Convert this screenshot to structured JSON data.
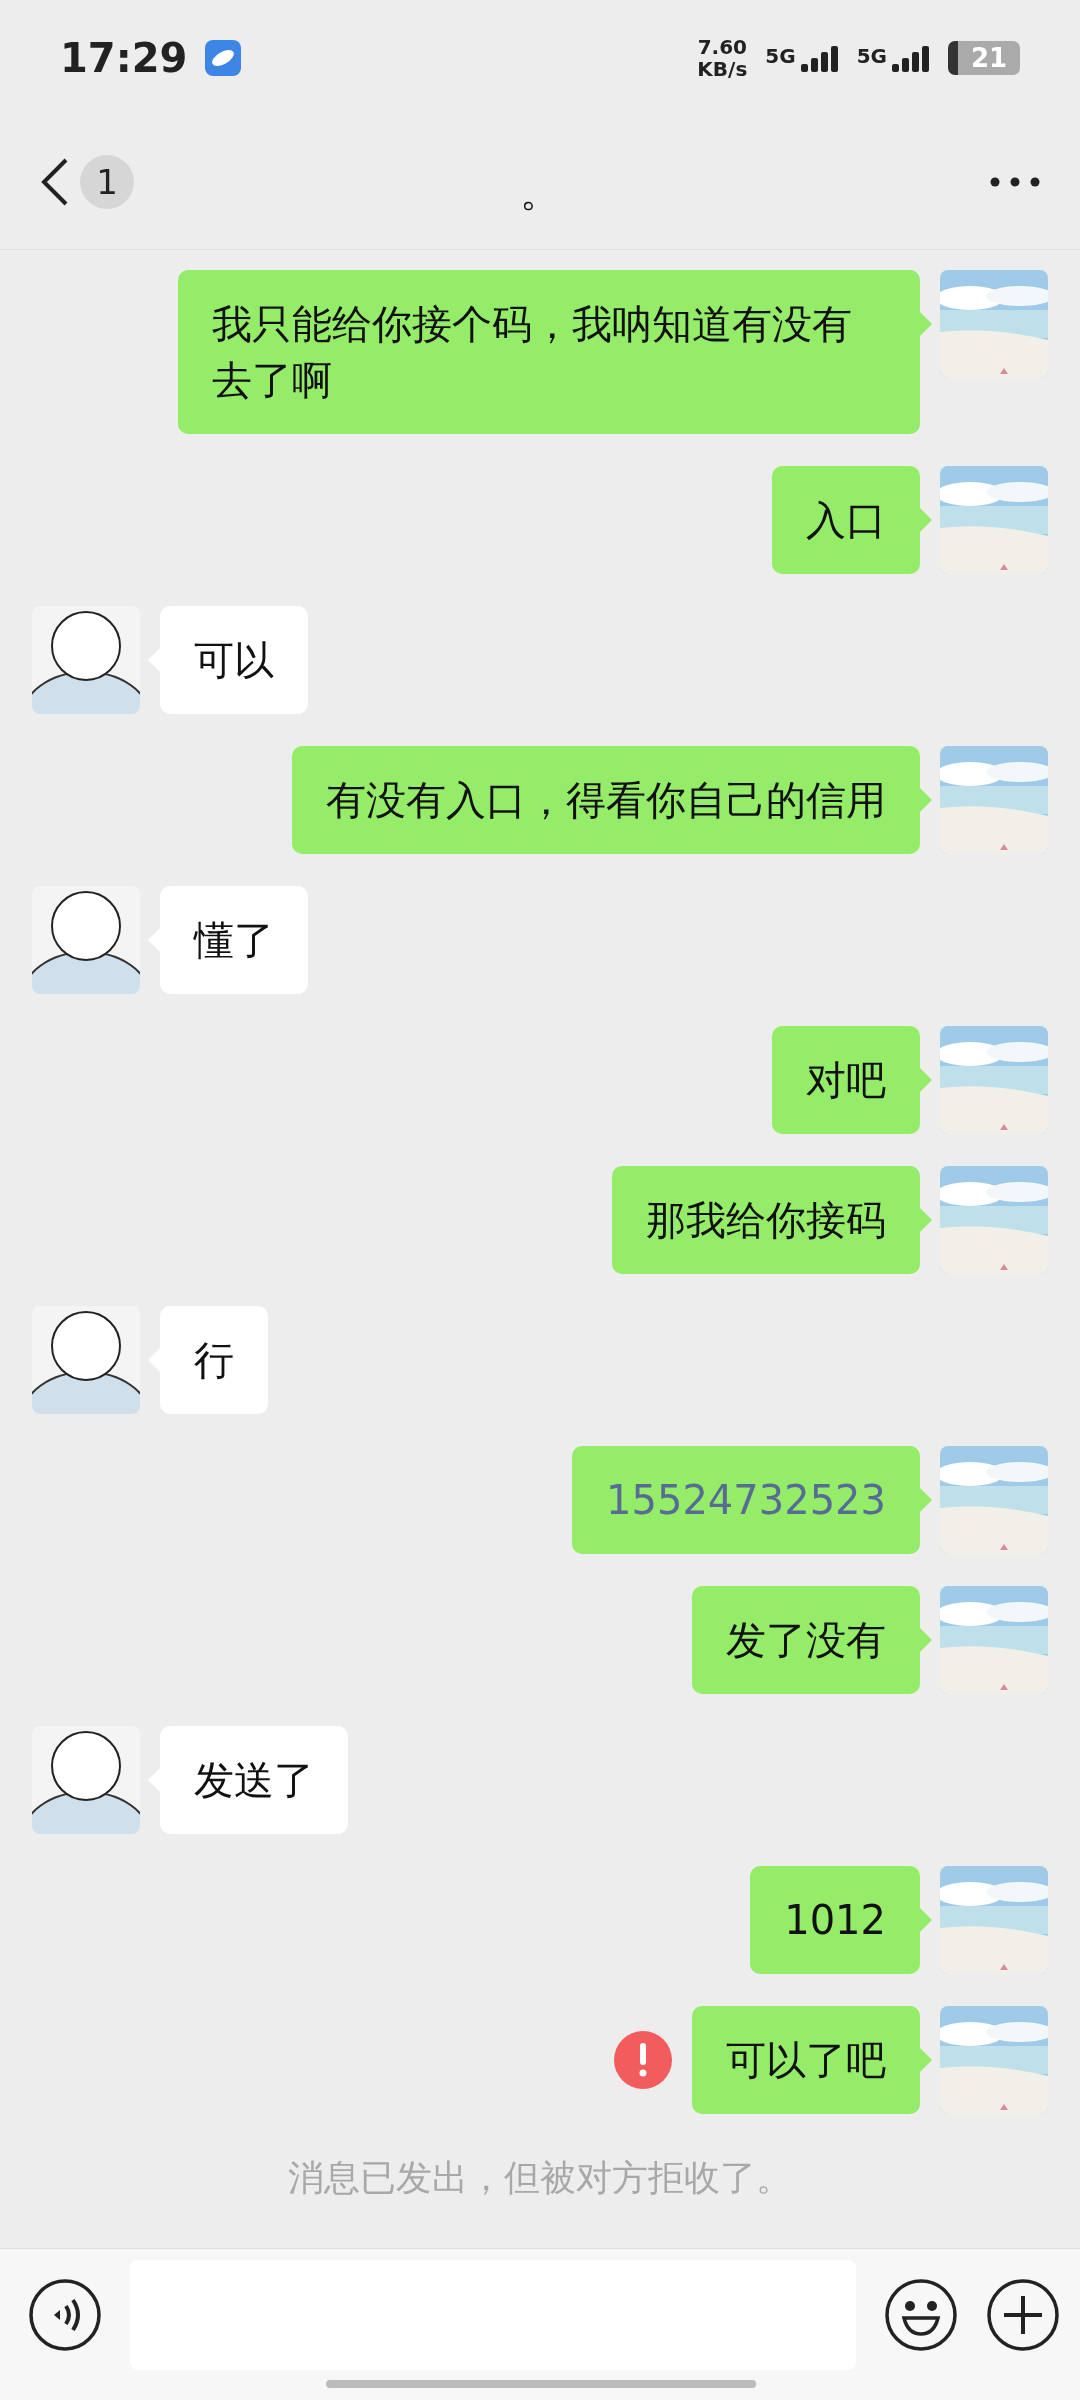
{
  "status_bar": {
    "time": "17:29",
    "net_speed": "7.60",
    "net_unit": "KB/s",
    "signal_1": "5G",
    "signal_2": "5G",
    "battery": "21"
  },
  "header": {
    "unread_badge": "1",
    "title": "。"
  },
  "messages": [
    {
      "outgoing": true,
      "kind": "text",
      "text": "我只能给你接个码，我呐知道有没有去了啊",
      "failed": false
    },
    {
      "outgoing": true,
      "kind": "text",
      "text": "入口",
      "failed": false
    },
    {
      "outgoing": false,
      "kind": "text",
      "text": "可以",
      "failed": false
    },
    {
      "outgoing": true,
      "kind": "text",
      "text": "有没有入口，得看你自己的信用",
      "failed": false
    },
    {
      "outgoing": false,
      "kind": "text",
      "text": "懂了",
      "failed": false
    },
    {
      "outgoing": true,
      "kind": "text",
      "text": "对吧",
      "failed": false
    },
    {
      "outgoing": true,
      "kind": "text",
      "text": "那我给你接码",
      "failed": false
    },
    {
      "outgoing": false,
      "kind": "text",
      "text": "行",
      "failed": false
    },
    {
      "outgoing": true,
      "kind": "link",
      "text": "15524732523",
      "failed": false
    },
    {
      "outgoing": true,
      "kind": "text",
      "text": "发了没有",
      "failed": false
    },
    {
      "outgoing": false,
      "kind": "text",
      "text": "发送了",
      "failed": false
    },
    {
      "outgoing": true,
      "kind": "text",
      "text": "1012",
      "failed": false
    },
    {
      "outgoing": true,
      "kind": "text",
      "text": "可以了吧",
      "failed": true
    }
  ],
  "system_notice": "消息已发出，但被对方拒收了。"
}
